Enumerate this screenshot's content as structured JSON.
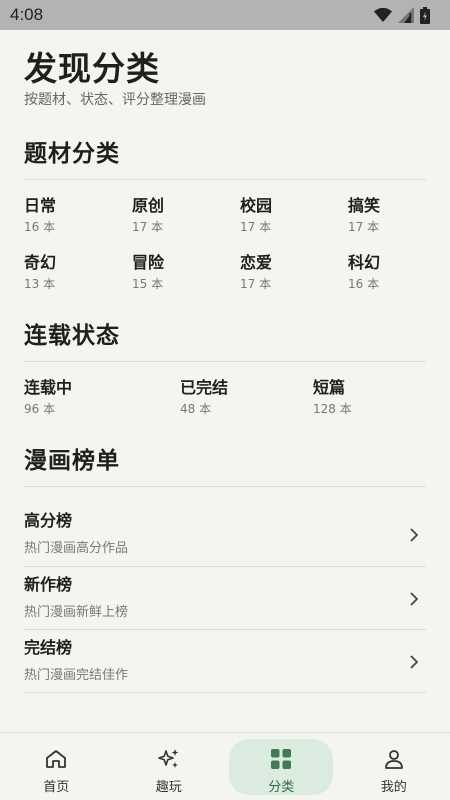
{
  "status_bar": {
    "time": "4:08",
    "icons": [
      "wifi-icon",
      "signal-icon",
      "battery-icon"
    ]
  },
  "header": {
    "title": "发现分类",
    "subtitle": "按题材、状态、评分整理漫画"
  },
  "genres": {
    "title": "题材分类",
    "items": [
      {
        "name": "日常",
        "count": "16 本"
      },
      {
        "name": "原创",
        "count": "17 本"
      },
      {
        "name": "校园",
        "count": "17 本"
      },
      {
        "name": "搞笑",
        "count": "17 本"
      },
      {
        "name": "奇幻",
        "count": "13 本"
      },
      {
        "name": "冒险",
        "count": "15 本"
      },
      {
        "name": "恋爱",
        "count": "17 本"
      },
      {
        "name": "科幻",
        "count": "16 本"
      }
    ]
  },
  "serial_status": {
    "title": "连载状态",
    "items": [
      {
        "name": "连载中",
        "count": "96 本"
      },
      {
        "name": "已完结",
        "count": "48 本"
      },
      {
        "name": "短篇",
        "count": "128 本"
      }
    ]
  },
  "rankings": {
    "title": "漫画榜单",
    "items": [
      {
        "title": "高分榜",
        "desc": "热门漫画高分作品"
      },
      {
        "title": "新作榜",
        "desc": "热门漫画新鲜上榜"
      },
      {
        "title": "完结榜",
        "desc": "热门漫画完结佳作"
      }
    ]
  },
  "bottom_nav": {
    "items": [
      {
        "label": "首页",
        "icon": "home-icon"
      },
      {
        "label": "趣玩",
        "icon": "sparkle-icon"
      },
      {
        "label": "分类",
        "icon": "grid-icon",
        "active": true
      },
      {
        "label": "我的",
        "icon": "user-icon"
      }
    ]
  },
  "colors": {
    "background": "#f5f5f0",
    "accent": "#2f6b47",
    "accent_bg": "#dcebe0",
    "status_bar": "#b3b3b3"
  }
}
